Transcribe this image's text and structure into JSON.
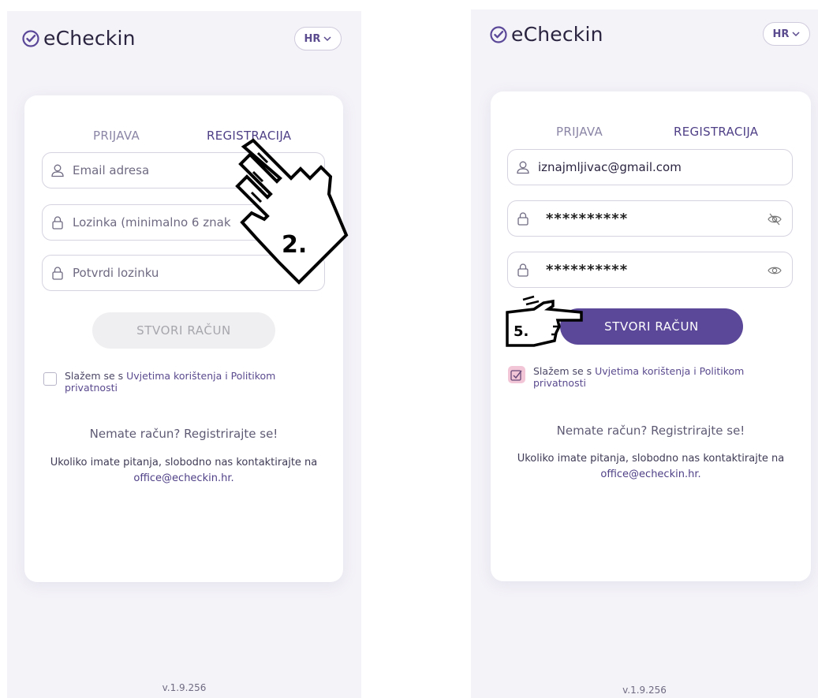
{
  "app": {
    "name": "eCheckin",
    "language": "HR",
    "version": "v.1.9.256"
  },
  "screens": [
    {
      "tabs": {
        "login": "PRIJAVA",
        "register": "REGISTRACIJA"
      },
      "fields": {
        "email": {
          "placeholder": "Email adresa",
          "value": ""
        },
        "password": {
          "placeholder": "Lozinka (minimalno 6 znak",
          "value": ""
        },
        "confirm": {
          "placeholder": "Potvrdi lozinku",
          "value": ""
        }
      },
      "create_button": "STVORI RAČUN",
      "create_enabled": false,
      "agree": {
        "prefix": "Slažem se s ",
        "link": "Uvjetima korištenja i Politikom privatnosti",
        "checked": false
      },
      "no_account": "Nemate račun? Registrirajte se!",
      "contact": {
        "text": "Ukoliko imate pitanja, slobodno nas kontaktirajte na",
        "email": "office@echeckin.hr."
      },
      "step_label": "2."
    },
    {
      "tabs": {
        "login": "PRIJAVA",
        "register": "REGISTRACIJA"
      },
      "fields": {
        "email": {
          "placeholder": "",
          "value": "iznajmljivac@gmail.com"
        },
        "password": {
          "placeholder": "",
          "value": "**********"
        },
        "confirm": {
          "placeholder": "",
          "value": "**********"
        }
      },
      "create_button": "STVORI RAČUN",
      "create_enabled": true,
      "agree": {
        "prefix": "Slažem se s ",
        "link": "Uvjetima korištenja i Politikom privatnosti",
        "checked": true
      },
      "no_account": "Nemate račun? Registrirajte se!",
      "contact": {
        "text": "Ukoliko imate pitanja, slobodno nas kontaktirajte na",
        "email": "office@echeckin.hr."
      },
      "step_label": "5."
    }
  ],
  "colors": {
    "brand": "#5b4898",
    "disabled_button": "#efeff1",
    "background": "#f4f3f8"
  },
  "icons": [
    "check-circle-icon",
    "chevron-down-icon",
    "user-icon",
    "lock-icon",
    "eye-off-icon",
    "eye-icon",
    "checkbox-check-icon",
    "pointing-hand-icon"
  ]
}
